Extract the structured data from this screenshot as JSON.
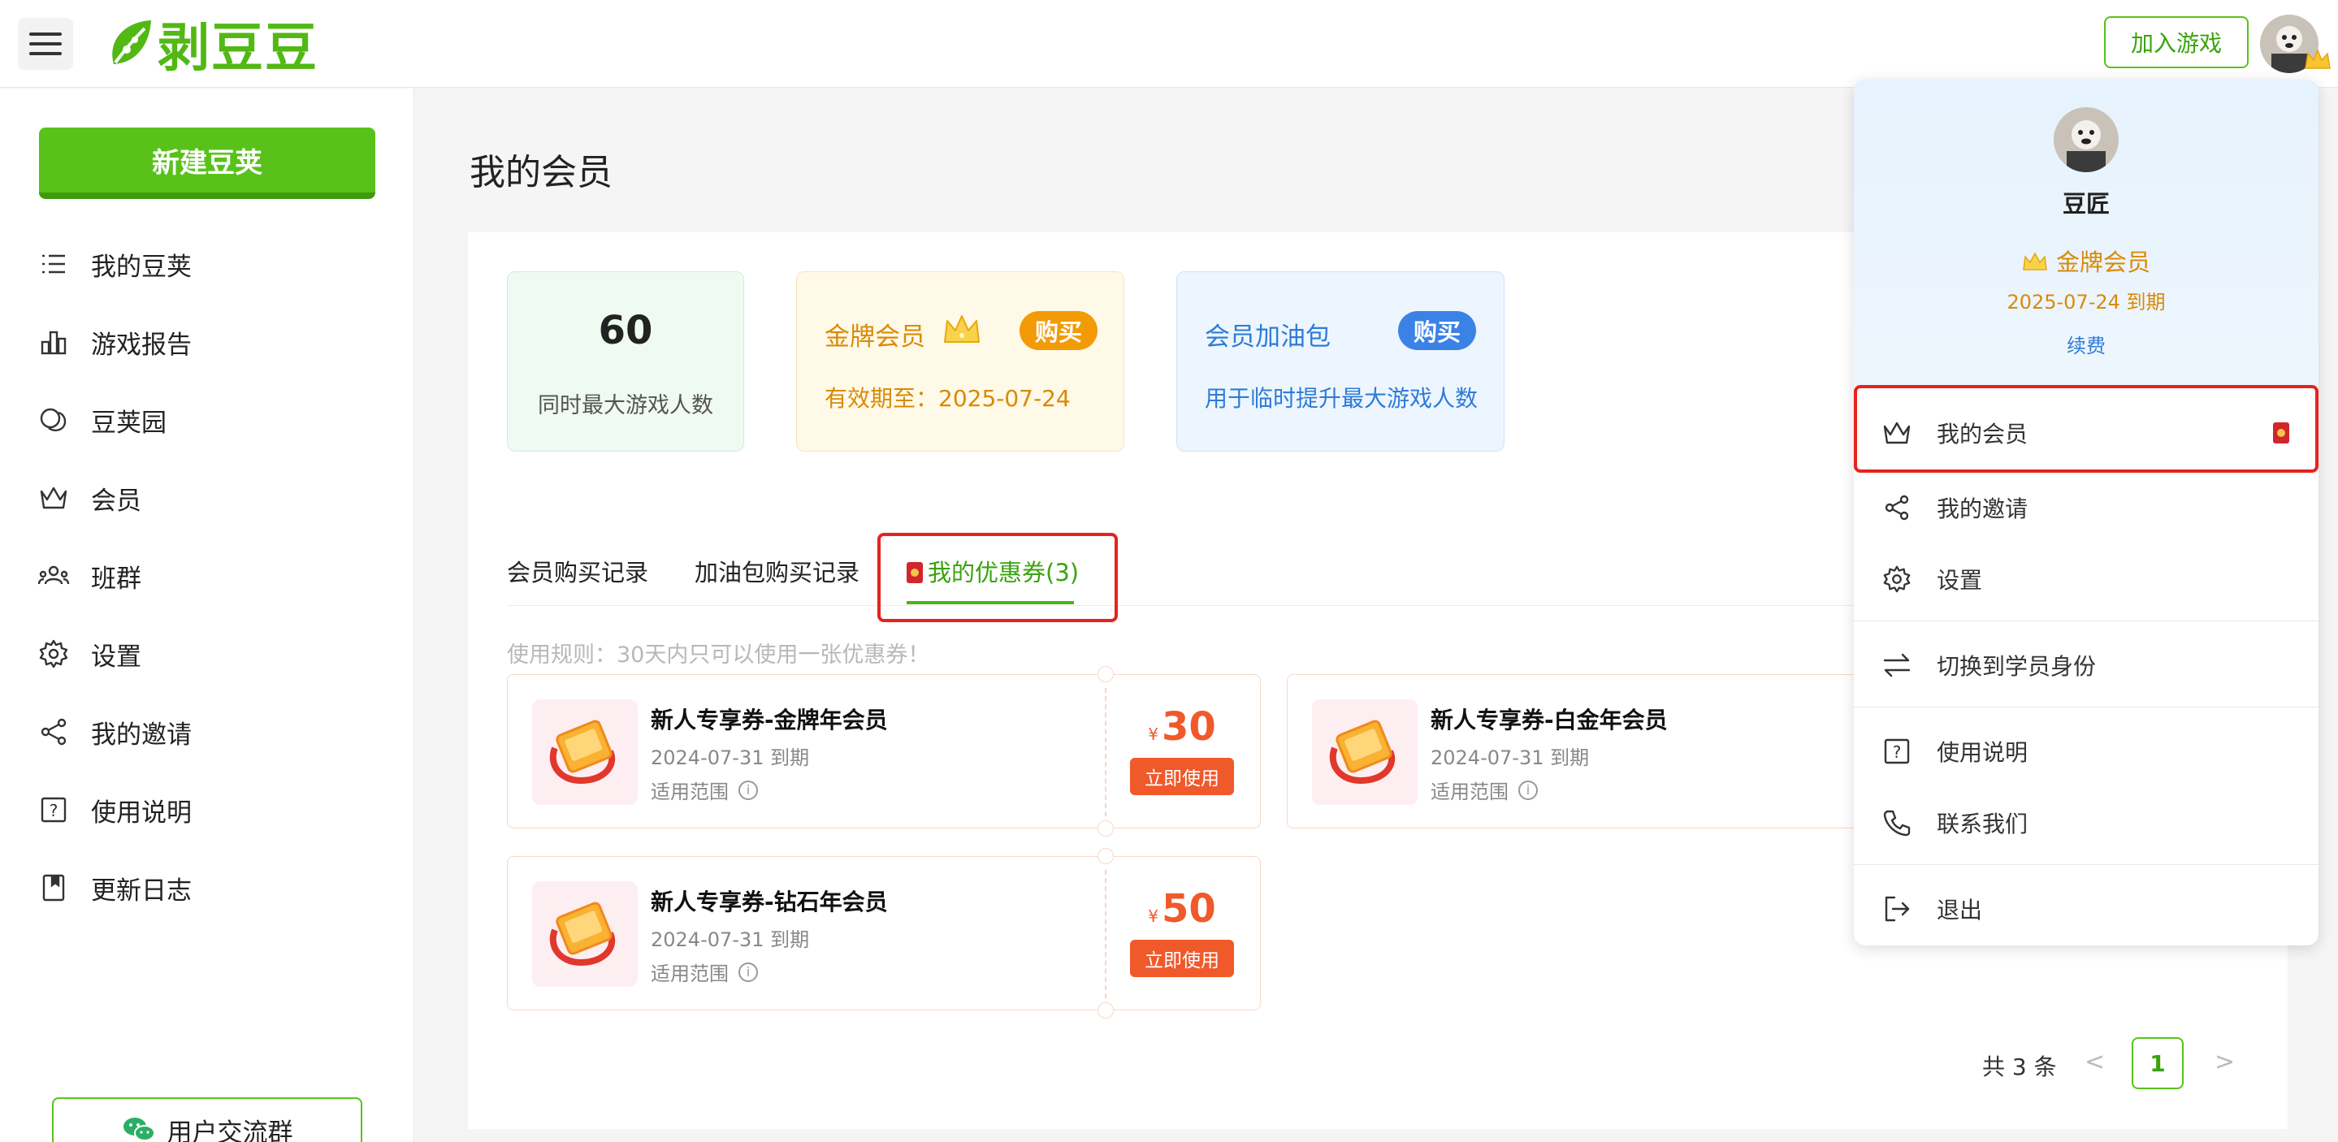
{
  "header": {
    "logo_text": "剥豆豆",
    "join_button": "加入游戏"
  },
  "sidebar": {
    "new_button": "新建豆荚",
    "items": [
      {
        "label": "我的豆荚",
        "icon": "list-icon"
      },
      {
        "label": "游戏报告",
        "icon": "bar-chart-icon"
      },
      {
        "label": "豆荚园",
        "icon": "garden-icon"
      },
      {
        "label": "会员",
        "icon": "crown-icon"
      },
      {
        "label": "班群",
        "icon": "group-icon"
      },
      {
        "label": "设置",
        "icon": "gear-icon"
      },
      {
        "label": "我的邀请",
        "icon": "share-icon"
      },
      {
        "label": "使用说明",
        "icon": "help-icon"
      },
      {
        "label": "更新日志",
        "icon": "book-icon"
      }
    ],
    "group_button": "用户交流群"
  },
  "main": {
    "title": "我的会员",
    "stats": {
      "max_players_value": "60",
      "max_players_label": "同时最大游戏人数",
      "gold_title": "金牌会员",
      "gold_buy": "购买",
      "gold_validity": "有效期至：2025-07-24",
      "pack_title": "会员加油包",
      "pack_buy": "购买",
      "pack_desc": "用于临时提升最大游戏人数"
    },
    "tabs": [
      {
        "label": "会员购买记录"
      },
      {
        "label": "加油包购买记录"
      },
      {
        "label": "我的优惠券(3)"
      }
    ],
    "rule": "使用规则：30天内只可以使用一张优惠券！",
    "coupons": [
      {
        "name": "新人专享券-金牌年会员",
        "date": "2024-07-31 到期",
        "scope": "适用范围",
        "currency": "¥",
        "amount": "30",
        "use": "立即使用"
      },
      {
        "name": "新人专享券-白金年会员",
        "date": "2024-07-31 到期",
        "scope": "适用范围",
        "currency": "¥",
        "amount": "",
        "use": ""
      },
      {
        "name": "新人专享券-钻石年会员",
        "date": "2024-07-31 到期",
        "scope": "适用范围",
        "currency": "¥",
        "amount": "50",
        "use": "立即使用"
      }
    ],
    "pager": {
      "total": "共 3 条",
      "prev": "<",
      "page": "1",
      "next": ">"
    }
  },
  "dropdown": {
    "name": "豆匠",
    "level": "金牌会员",
    "expiry": "2025-07-24  到期",
    "renew": "续费",
    "items": [
      {
        "label": "我的会员",
        "icon": "crown-icon"
      },
      {
        "label": "我的邀请",
        "icon": "share-icon"
      },
      {
        "label": "设置",
        "icon": "gear-icon"
      },
      {
        "label": "切换到学员身份",
        "icon": "switch-icon"
      },
      {
        "label": "使用说明",
        "icon": "help-icon"
      },
      {
        "label": "联系我们",
        "icon": "phone-icon"
      },
      {
        "label": "退出",
        "icon": "logout-icon"
      }
    ]
  },
  "colors": {
    "brand_green": "#59c21a",
    "gold": "#d98a05",
    "blue": "#2e7bd8",
    "coupon_orange": "#f0592a",
    "highlight_red": "#e6231f"
  }
}
